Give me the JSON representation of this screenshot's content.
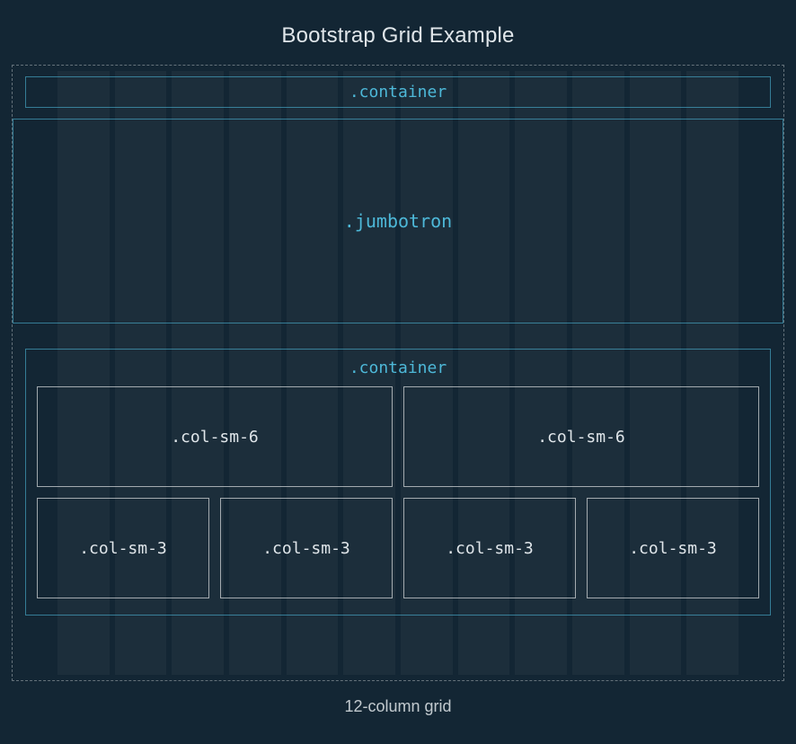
{
  "title": "Bootstrap Grid Example",
  "footer": "12-column grid",
  "grid": {
    "columns": 12,
    "container_top_label": ".container",
    "jumbotron_label": ".jumbotron",
    "container_bottom_label": ".container",
    "row1": [
      {
        "label": ".col-sm-6"
      },
      {
        "label": ".col-sm-6"
      }
    ],
    "row2": [
      {
        "label": ".col-sm-3"
      },
      {
        "label": ".col-sm-3"
      },
      {
        "label": ".col-sm-3"
      },
      {
        "label": ".col-sm-3"
      }
    ]
  }
}
